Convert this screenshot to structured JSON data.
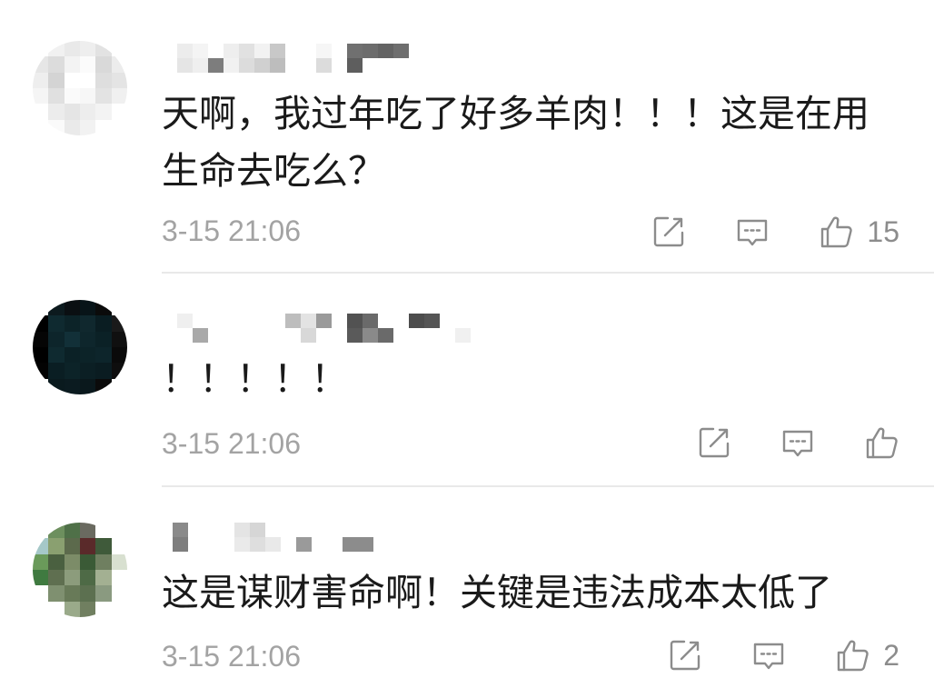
{
  "colors": {
    "text": "#1a1a1a",
    "meta": "#a3a3a3",
    "icon": "#8c8c8c",
    "divider": "#e9e9e9"
  },
  "comments": [
    {
      "avatar_mosaic": [
        [
          "#ffffff",
          "#f1f1f1",
          "#e9e9e9",
          "#eeeeee",
          "#e2e2e2",
          "#ffffff"
        ],
        [
          "#e6e6e6",
          "#dcdcdc",
          "#f3f3f3",
          "#fbfbfb",
          "#d9d9d9",
          "#ececec"
        ],
        [
          "#eeeeee",
          "#d4d4d4",
          "#ffffff",
          "#ffffff",
          "#dedede",
          "#e4e4e4"
        ],
        [
          "#f5f5f5",
          "#e0e0e0",
          "#fafafa",
          "#f7f7f7",
          "#e3e3e3",
          "#f0f0f0"
        ],
        [
          "#ffffff",
          "#ececec",
          "#e5e5e5",
          "#ededed",
          "#f3f3f3",
          "#ffffff"
        ],
        [
          "#ffffff",
          "#fafafa",
          "#eaeaea",
          "#f2f2f2",
          "#ffffff",
          "#ffffff"
        ]
      ],
      "username_mosaic": [
        [
          "#ececec",
          "#f4f4f4",
          "#ffffff",
          "#eeeeee",
          "#e1e1e1",
          "#f2f2f2",
          "#c8c8c8",
          "#ffffff",
          "#ffffff",
          "#f6f6f6",
          "#ffffff",
          "#707070",
          "#6c6c6c",
          "#636363",
          "#6e6e6e",
          "#ffffff"
        ],
        [
          "#e5e5e5",
          "#efefef",
          "#7d7d7d",
          "#f1f1f1",
          "#dcdcdc",
          "#d0d0d0",
          "#bdbdbd",
          "#ffffff",
          "#ffffff",
          "#dcdcdc",
          "#ffffff",
          "#5e5e5e",
          "#ffffff",
          "#ffffff",
          "#ffffff",
          "#ffffff"
        ]
      ],
      "text": "天啊，我过年吃了好多羊肉！！！这是在用生命去吃么？",
      "time": "3-15 21:06",
      "actions": {
        "share_icon": "share-icon",
        "comment_icon": "comment-icon",
        "like_icon": "thumbs-up-icon",
        "like_count": "15"
      }
    },
    {
      "avatar_mosaic": [
        [
          "#ffffff",
          "#0c1a1e",
          "#0a0f12",
          "#081418",
          "#0b0b0b",
          "#f5f5f5"
        ],
        [
          "#000000",
          "#0f2a30",
          "#0c2328",
          "#10282e",
          "#0a1d22",
          "#1a1a1a"
        ],
        [
          "#050505",
          "#0d252b",
          "#123038",
          "#0e262c",
          "#0b2126",
          "#101010"
        ],
        [
          "#000000",
          "#0f2a30",
          "#0b2126",
          "#0c2328",
          "#0d252b",
          "#0a0a0a"
        ],
        [
          "#030303",
          "#0a1e23",
          "#0c2328",
          "#0b1f24",
          "#0a1c21",
          "#0e0e0e"
        ],
        [
          "#ffffff",
          "#0a1a1e",
          "#0b1b20",
          "#0a181c",
          "#0b0b0b",
          "#ffffff"
        ]
      ],
      "username_mosaic": [
        [
          "#efefef",
          "#ffffff",
          "#ffffff",
          "#ffffff",
          "#ffffff",
          "#ffffff",
          "#ffffff",
          "#bdbdbd",
          "#e3e3e3",
          "#9a9a9a",
          "#ffffff",
          "#525252",
          "#6a6a6a",
          "#ffffff",
          "#ffffff",
          "#4d4d4d",
          "#555555",
          "#ffffff",
          "#ffffff",
          "#ffffff"
        ],
        [
          "#ffffff",
          "#a9a9a9",
          "#ffffff",
          "#ffffff",
          "#ffffff",
          "#ffffff",
          "#ffffff",
          "#ffffff",
          "#d8d8d8",
          "#ffffff",
          "#ffffff",
          "#5a5a5a",
          "#8a8a8a",
          "#6a6a6a",
          "#ffffff",
          "#ffffff",
          "#ffffff",
          "#ffffff",
          "#f0f0f0",
          "#ffffff"
        ]
      ],
      "text": "！！！！！",
      "time": "3-15 21:06",
      "actions": {
        "share_icon": "share-icon",
        "comment_icon": "comment-icon",
        "like_icon": "thumbs-up-icon"
      }
    },
    {
      "avatar_mosaic": [
        [
          "#ffffff",
          "#6d8f5e",
          "#4f7048",
          "#6a6a60",
          "#ffffff",
          "#ffffff"
        ],
        [
          "#a5c8c8",
          "#8aa070",
          "#5c6a4c",
          "#5a2a2a",
          "#3f5a3a",
          "#ffffff"
        ],
        [
          "#6a9a5a",
          "#4a6040",
          "#7c8c68",
          "#3a5a36",
          "#6f7f60",
          "#d8e0d0"
        ],
        [
          "#3f7a40",
          "#5f6f50",
          "#8c9c7c",
          "#4e6a46",
          "#a3b092",
          "#ffffff"
        ],
        [
          "#ffffff",
          "#7f9070",
          "#687a58",
          "#5c7050",
          "#8a9a80",
          "#ffffff"
        ],
        [
          "#ffffff",
          "#ffffff",
          "#9aaa8a",
          "#707f60",
          "#ffffff",
          "#ffffff"
        ]
      ],
      "username_mosaic": [
        [
          "#8a8a8a",
          "#ffffff",
          "#ffffff",
          "#ffffff",
          "#e4e4e4",
          "#d6d6d6",
          "#ffffff",
          "#ffffff",
          "#ffffff",
          "#ffffff",
          "#ffffff",
          "#ffffff",
          "#ffffff",
          "#ffffff"
        ],
        [
          "#7e7e7e",
          "#ffffff",
          "#ffffff",
          "#ffffff",
          "#eaeaea",
          "#dedede",
          "#e9e9e9",
          "#ffffff",
          "#9a9a9a",
          "#ffffff",
          "#ffffff",
          "#8c8c8c",
          "#8c8c8c",
          "#ffffff"
        ]
      ],
      "text": "这是谋财害命啊！关键是违法成本太低了",
      "time": "3-15 21:06",
      "actions": {
        "share_icon": "share-icon",
        "comment_icon": "comment-icon",
        "like_icon": "thumbs-up-icon",
        "like_count": "2"
      }
    }
  ]
}
